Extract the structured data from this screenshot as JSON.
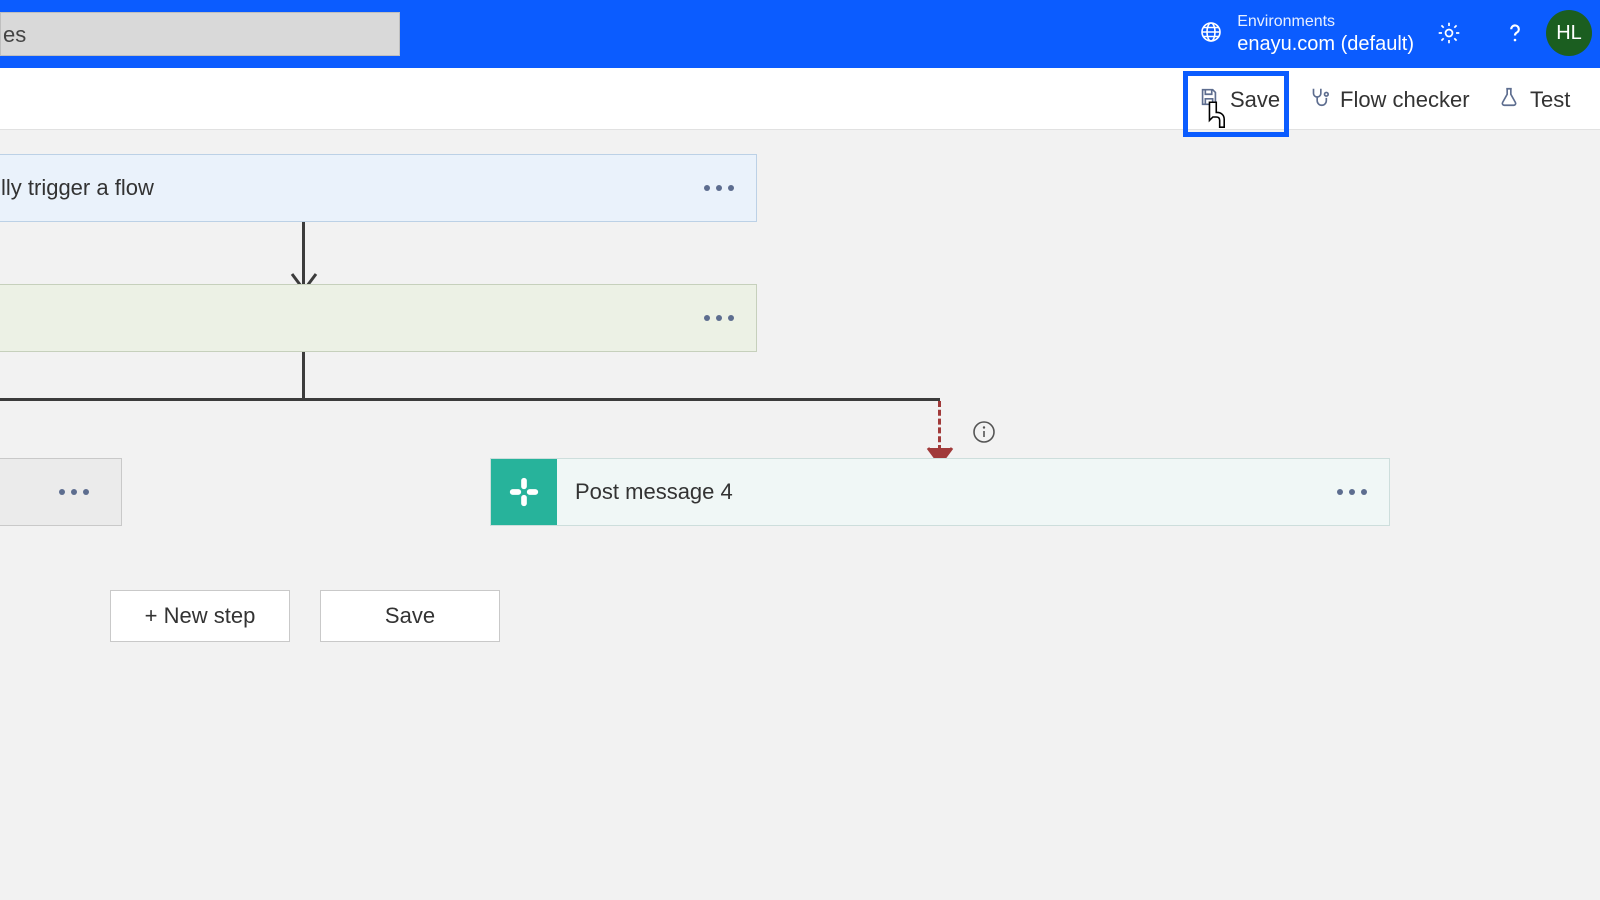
{
  "header": {
    "search_value": "es",
    "env_label": "Environments",
    "env_name": "enayu.com (default)",
    "avatar_initials": "HL"
  },
  "toolbar": {
    "save_label": "Save",
    "flow_checker_label": "Flow checker",
    "test_label": "Test"
  },
  "nodes": {
    "trigger_label": "lly trigger a flow",
    "post_message_label": "Post message 4"
  },
  "buttons": {
    "new_step_label": "+ New step",
    "save_label": "Save"
  }
}
